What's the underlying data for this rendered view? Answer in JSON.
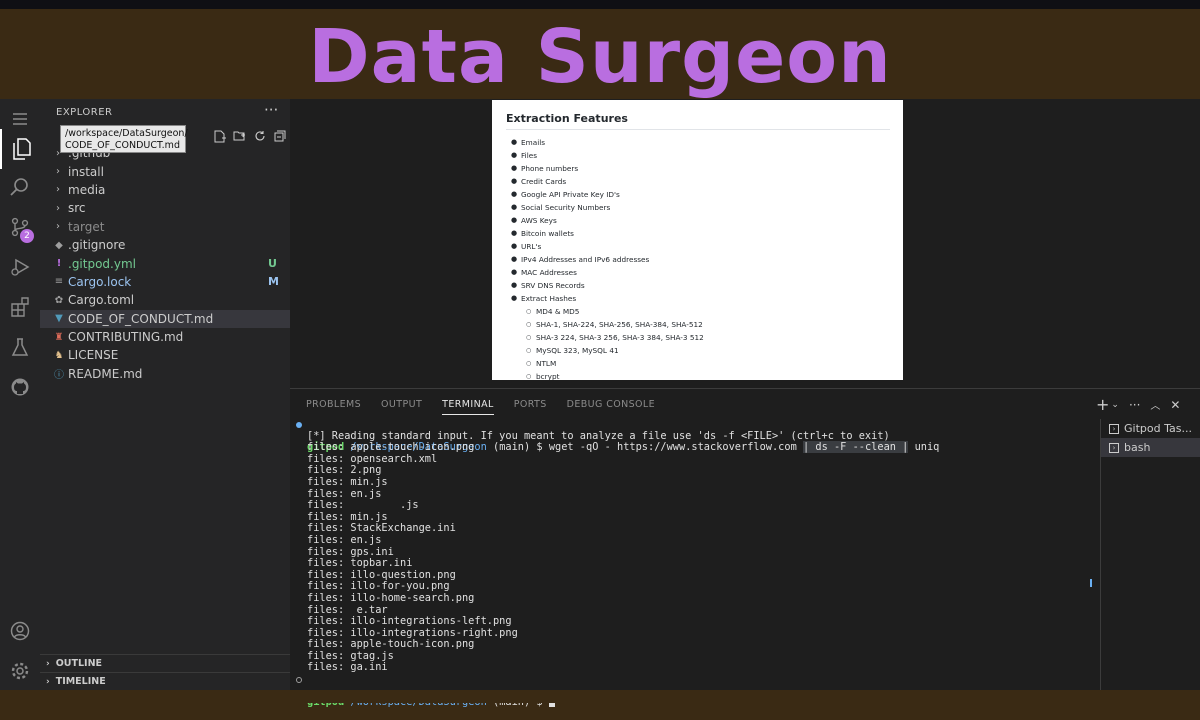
{
  "banner": {
    "title": "Data Surgeon"
  },
  "activity_bar": {
    "items": [
      "explorer-icon",
      "search-icon",
      "source-control-icon",
      "run-debug-icon",
      "extensions-icon",
      "testing-icon",
      "github-icon"
    ],
    "source_control_badge": "2",
    "bottom_items": [
      "account-icon",
      "settings-icon"
    ]
  },
  "sidebar": {
    "title": "EXPLORER",
    "more": "···",
    "tooltip_line1": "/workspace/DataSurgeon/",
    "tooltip_line2": "CODE_OF_CONDUCT.md",
    "items": [
      {
        "label": ".github",
        "type": "folder",
        "status": ""
      },
      {
        "label": "install",
        "type": "folder",
        "status": ""
      },
      {
        "label": "media",
        "type": "folder",
        "status": ""
      },
      {
        "label": "src",
        "type": "folder",
        "status": ""
      },
      {
        "label": "target",
        "type": "folder",
        "status": ""
      },
      {
        "label": ".gitignore",
        "type": "file",
        "status": ""
      },
      {
        "label": ".gitpod.yml",
        "type": "file",
        "status": "U"
      },
      {
        "label": "Cargo.lock",
        "type": "file",
        "status": "M"
      },
      {
        "label": "Cargo.toml",
        "type": "file",
        "status": ""
      },
      {
        "label": "CODE_OF_CONDUCT.md",
        "type": "file",
        "status": ""
      },
      {
        "label": "CONTRIBUTING.md",
        "type": "file",
        "status": ""
      },
      {
        "label": "LICENSE",
        "type": "file",
        "status": ""
      },
      {
        "label": "README.md",
        "type": "file",
        "status": ""
      }
    ],
    "outline": "OUTLINE",
    "timeline": "TIMELINE"
  },
  "preview": {
    "title": "Extraction Features",
    "items": [
      "Emails",
      "Files",
      "Phone numbers",
      "Credit Cards",
      "Google API Private Key ID's",
      "Social Security Numbers",
      "AWS Keys",
      "Bitcoin wallets",
      "URL's",
      "IPv4 Addresses and IPv6 addresses",
      "MAC Addresses",
      "SRV DNS Records",
      "Extract Hashes"
    ],
    "sub_items": [
      "MD4 & MD5",
      "SHA-1, SHA-224, SHA-256, SHA-384, SHA-512",
      "SHA-3 224, SHA-3 256, SHA-3 384, SHA-3 512",
      "MySQL 323, MySQL 41",
      "NTLM",
      "bcrypt"
    ]
  },
  "panel": {
    "tabs": [
      "PROBLEMS",
      "OUTPUT",
      "TERMINAL",
      "PORTS",
      "DEBUG CONSOLE"
    ],
    "active_tab": "TERMINAL",
    "terminals": [
      "Gitpod Tas...",
      "bash"
    ]
  },
  "terminal": {
    "prompt_user": "gitpod",
    "prompt_path": "/workspace/DataSurgeon",
    "prompt_branch": "(main) $",
    "command_a": "wget -qO - https://www.stackoverflow.com ",
    "command_b": "| ds -F --clean |",
    "command_c": " uniq",
    "info": "[*] Reading standard input. If you meant to analyze a file use 'ds -f <FILE>' (ctrl+c to exit)",
    "lines": [
      "files: apple-touch-icon.png",
      "files: opensearch.xml",
      "files: 2.png",
      "files: min.js",
      "files: en.js",
      "files:         .js",
      "files: min.js",
      "files: StackExchange.ini",
      "files: en.js",
      "files: gps.ini",
      "files: topbar.ini",
      "files: illo-question.png",
      "files: illo-for-you.png",
      "files: illo-home-search.png",
      "files:  e.tar",
      "files: illo-integrations-left.png",
      "files: illo-integrations-right.png",
      "files: apple-touch-icon.png",
      "files: gtag.js",
      "files: ga.ini"
    ]
  },
  "colors": {
    "accent": "#b96ee0",
    "prompt_green": "#6bd968",
    "path_blue": "#6ab0f3"
  }
}
